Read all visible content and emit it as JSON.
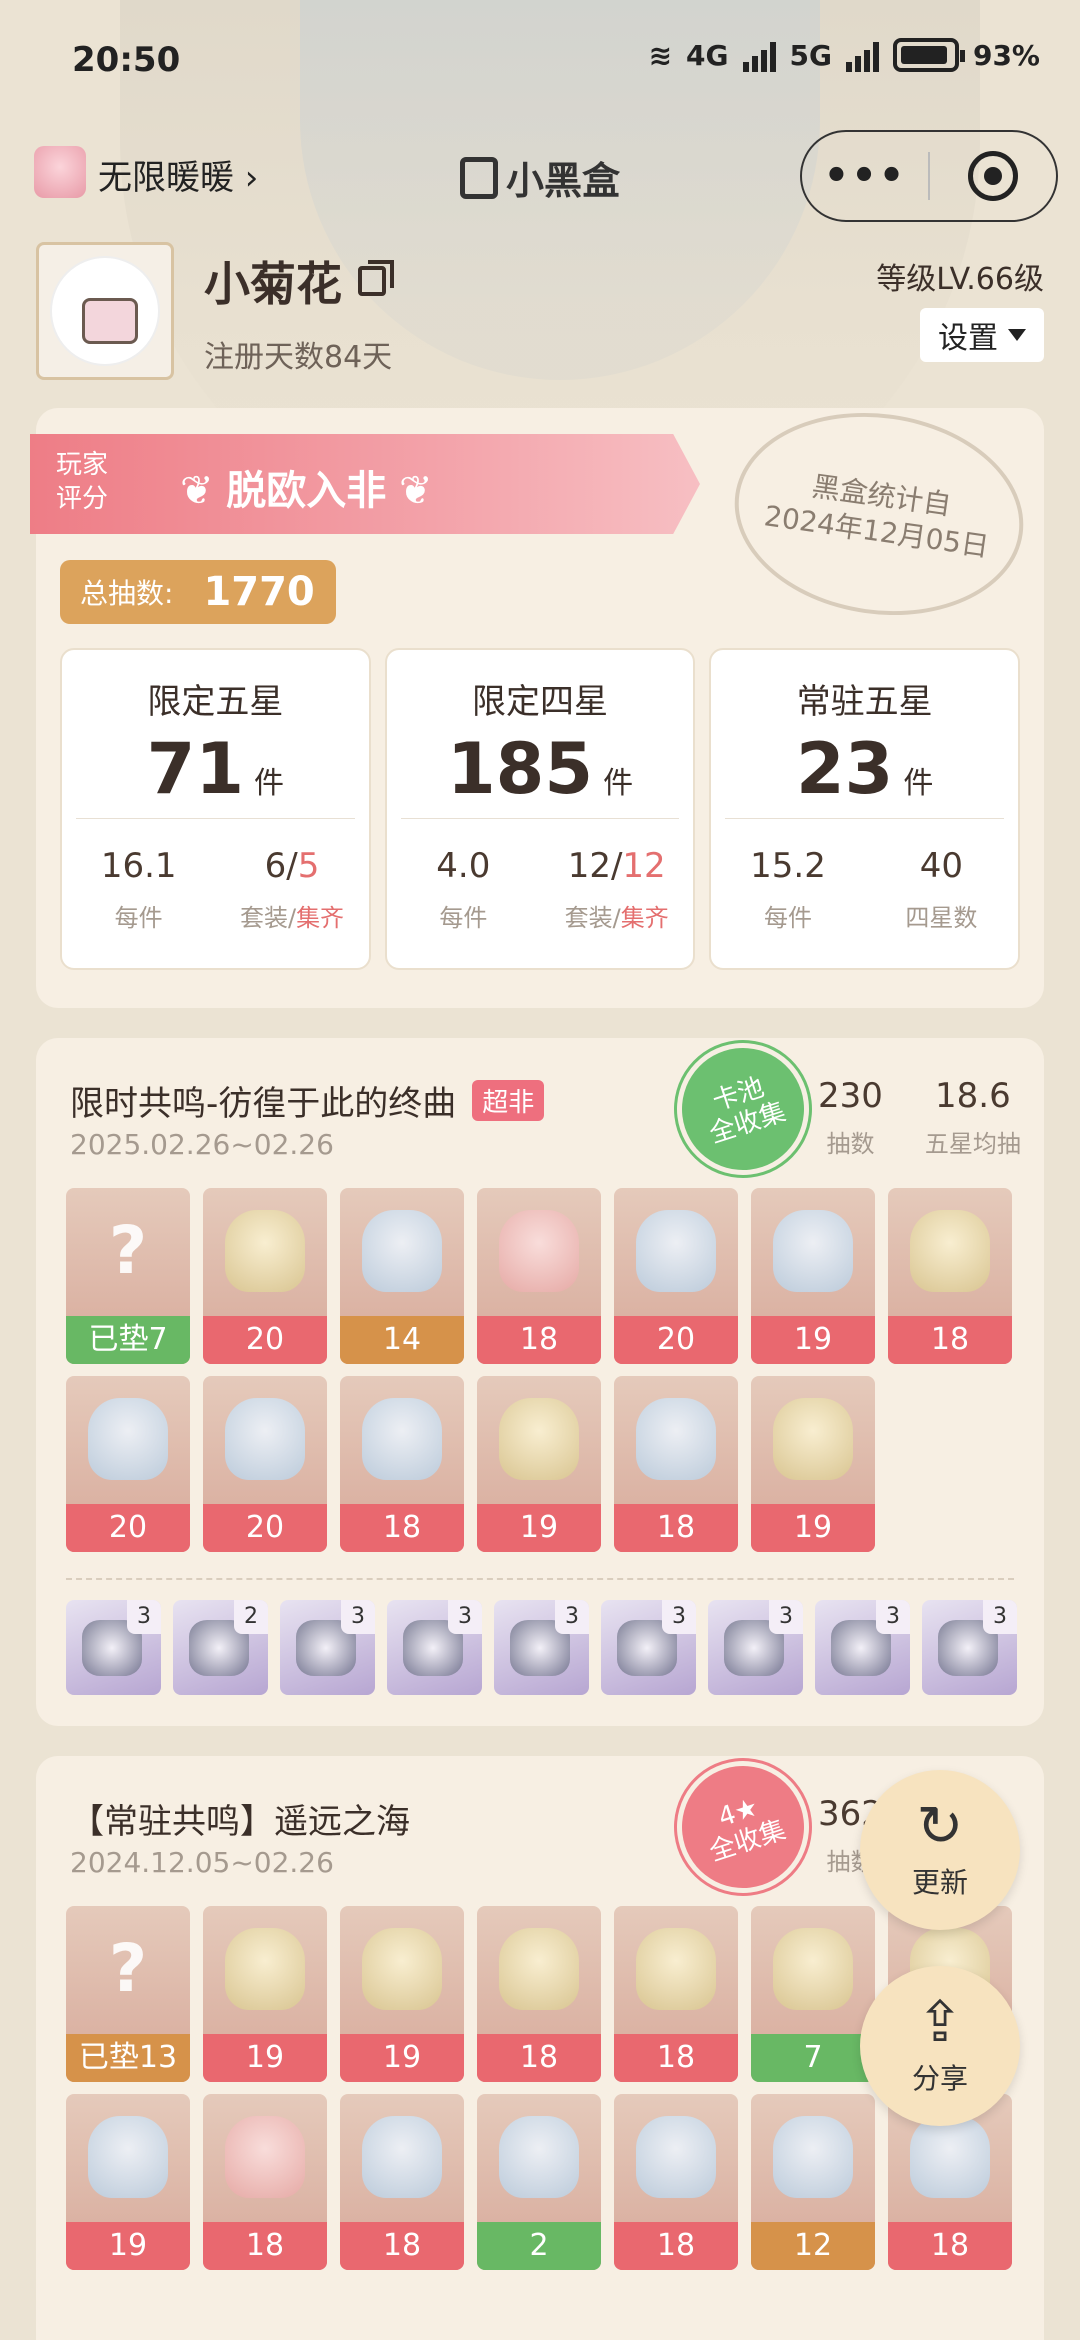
{
  "status_bar": {
    "time": "20:50",
    "network1": "4G",
    "network2": "5G",
    "battery": "93%"
  },
  "header": {
    "game_name": "无限暖暖 ›",
    "brand": "小黑盒"
  },
  "profile": {
    "name": "小菊花",
    "days": "注册天数84天",
    "level": "等级LV.66级",
    "settings": "设置"
  },
  "summary": {
    "rating_label": "玩家评分",
    "rating_value": "脱欧入非",
    "stamp": "黑盒统计自\n2024年12月05日",
    "total_label": "总抽数:",
    "total_value": "1770",
    "boxes": [
      {
        "title": "限定五星",
        "count": "71",
        "unit": "件",
        "sub1_v": "16.1",
        "sub1_l": "每件",
        "sub2_a": "6/",
        "sub2_b": "5",
        "sub2_la": "套装/",
        "sub2_lb": "集齐"
      },
      {
        "title": "限定四星",
        "count": "185",
        "unit": "件",
        "sub1_v": "4.0",
        "sub1_l": "每件",
        "sub2_a": "12/",
        "sub2_b": "12",
        "sub2_la": "套装/",
        "sub2_lb": "集齐"
      },
      {
        "title": "常驻五星",
        "count": "23",
        "unit": "件",
        "sub1_v": "15.2",
        "sub1_l": "每件",
        "sub2_a": "40",
        "sub2_b": "",
        "sub2_la": "四星数",
        "sub2_lb": ""
      }
    ]
  },
  "pool1": {
    "title": "限时共鸣-彷徨于此的终曲",
    "tag": "超非",
    "date": "2025.02.26~02.26",
    "seal": "卡池\n全收集",
    "pulls": "230",
    "pulls_label": "抽数",
    "avg": "18.6",
    "avg_label": "五星均抽",
    "tiles": [
      {
        "label": "已垫7",
        "color": "green",
        "art": "q"
      },
      {
        "label": "20",
        "color": "red",
        "art": "gold"
      },
      {
        "label": "14",
        "color": "orange",
        "art": "blue"
      },
      {
        "label": "18",
        "color": "red",
        "art": "pink"
      },
      {
        "label": "20",
        "color": "red",
        "art": "blue"
      },
      {
        "label": "19",
        "color": "red",
        "art": "blue"
      },
      {
        "label": "18",
        "color": "red",
        "art": "gold"
      },
      {
        "label": "20",
        "color": "red",
        "art": "blue"
      },
      {
        "label": "20",
        "color": "red",
        "art": "blue"
      },
      {
        "label": "18",
        "color": "red",
        "art": "blue"
      },
      {
        "label": "19",
        "color": "red",
        "art": "gold"
      },
      {
        "label": "18",
        "color": "red",
        "art": "blue"
      },
      {
        "label": "19",
        "color": "red",
        "art": "gold"
      }
    ],
    "four_stars": [
      "3",
      "2",
      "3",
      "3",
      "3",
      "3",
      "3",
      "3",
      "3"
    ]
  },
  "pool2": {
    "title": "【常驻共鸣】遥远之海",
    "date": "2024.12.05~02.26",
    "seal": "4★\n全收集",
    "pulls": "362",
    "pulls_label": "抽数",
    "tiles": [
      {
        "label": "已垫13",
        "color": "orange",
        "art": "q"
      },
      {
        "label": "19",
        "color": "red",
        "art": "gold"
      },
      {
        "label": "19",
        "color": "red",
        "art": "gold"
      },
      {
        "label": "18",
        "color": "red",
        "art": "gold"
      },
      {
        "label": "18",
        "color": "red",
        "art": "gold"
      },
      {
        "label": "7",
        "color": "green",
        "art": "gold"
      },
      {
        "label": "",
        "color": "red",
        "art": "gold"
      },
      {
        "label": "19",
        "color": "red",
        "art": "blue"
      },
      {
        "label": "18",
        "color": "red",
        "art": "pink"
      },
      {
        "label": "18",
        "color": "red",
        "art": "blue"
      },
      {
        "label": "2",
        "color": "green",
        "art": "blue"
      },
      {
        "label": "18",
        "color": "red",
        "art": "blue"
      },
      {
        "label": "12",
        "color": "orange",
        "art": "blue"
      },
      {
        "label": "18",
        "color": "red",
        "art": "blue"
      }
    ]
  },
  "fab": {
    "refresh": "更新",
    "share": "分享"
  }
}
